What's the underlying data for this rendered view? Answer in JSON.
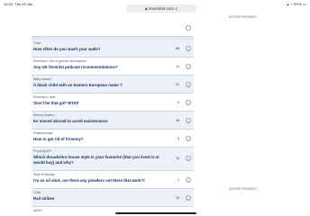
{
  "status": {
    "time": "10:23",
    "date": "Thu 23 Jun",
    "battery": "59%",
    "dots": "•••"
  },
  "browser": {
    "url": "mumsnet.com"
  },
  "ads": {
    "label_top": "ADVERTISEMENT",
    "label_mid": "ADVERTISEMENT"
  },
  "threads": [
    {
      "category": "Chat",
      "title": "How often do you wash your walls?",
      "count": "88"
    },
    {
      "category": "Feminism: Sex & gender discussions",
      "title": "Any UK feminist podcast recommendations?",
      "count": "11"
    },
    {
      "category": "Baby names",
      "title": "A black child with an Eastern European name ?",
      "count": "31"
    },
    {
      "category": "Feminism: chat",
      "title": "'Don't be that girl' WTAF",
      "count": "9"
    },
    {
      "category": "Money Matters",
      "title": "Ex moved abroad to avoid maintenance",
      "count": "38"
    },
    {
      "category": "Relationships",
      "title": "How to get rid of frenemy?",
      "count": "6"
    },
    {
      "category": "Property/DIY",
      "title": "Which decade/era house style is your favourite (that you lived in or would buy) and why?",
      "count": "16"
    },
    {
      "category": "Style & Beauty",
      "title": "I'm an oil slick, are there any powders out there that work?!",
      "count": "2"
    },
    {
      "category": "Chat",
      "title": "Rail strikes",
      "count": "13"
    },
    {
      "category": "AIBU?",
      "title": "",
      "count": ""
    }
  ]
}
